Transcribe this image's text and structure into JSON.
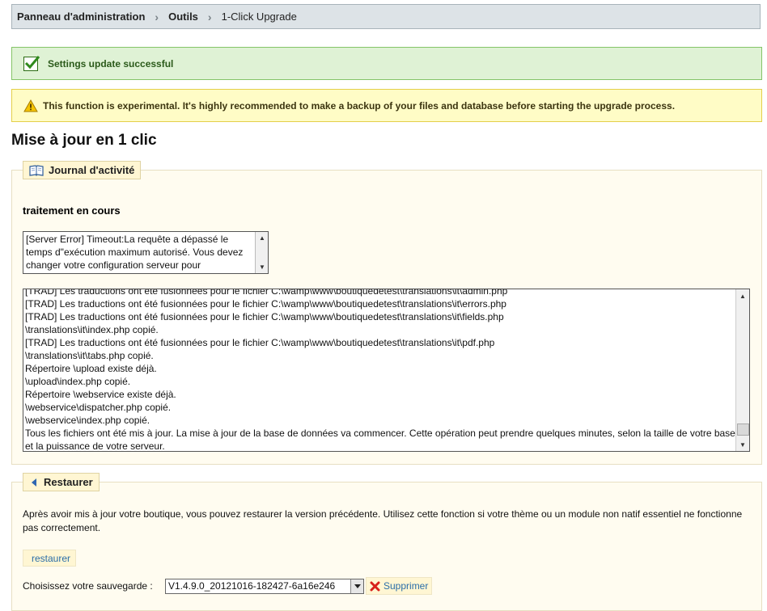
{
  "breadcrumb": {
    "items": [
      "Panneau d'administration",
      "Outils",
      "1-Click Upgrade"
    ]
  },
  "confirmation": {
    "text": "Settings update successful",
    "icon": "check-icon"
  },
  "warning": {
    "text": "This function is experimental. It's highly recommended to make a backup of your files and database before starting the upgrade process.",
    "icon": "warning-icon"
  },
  "page": {
    "title": "Mise à jour en 1 clic"
  },
  "activity": {
    "legend": "Journal d'activité",
    "legend_icon": "book-icon",
    "status": "traitement en cours",
    "error_log": "[Server Error] Timeout:La requête a dépassé le temps d\"exécution maximum autorisé. Vous devez changer votre configuration serveur pour",
    "log_lines": [
      "[TRAD] Les traductions ont été fusionnées pour le fichier C:\\wamp\\www\\boutiquedetest\\translations\\it\\admin.php",
      "[TRAD] Les traductions ont été fusionnées pour le fichier C:\\wamp\\www\\boutiquedetest\\translations\\it\\errors.php",
      "[TRAD] Les traductions ont été fusionnées pour le fichier C:\\wamp\\www\\boutiquedetest\\translations\\it\\fields.php",
      "\\translations\\it\\index.php copié.",
      "[TRAD] Les traductions ont été fusionnées pour le fichier C:\\wamp\\www\\boutiquedetest\\translations\\it\\pdf.php",
      "\\translations\\it\\tabs.php copié.",
      "Répertoire \\upload existe déjà.",
      "\\upload\\index.php copié.",
      "Répertoire \\webservice existe déjà.",
      "\\webservice\\dispatcher.php copié.",
      "\\webservice\\index.php copié.",
      "Tous les fichiers ont été mis à jour. La mise à jour de la base de données va commencer. Cette opération peut prendre quelques minutes, selon la taille de votre base et la puissance de votre serveur."
    ]
  },
  "restore": {
    "legend": "Restaurer",
    "legend_icon": "arrow-left-icon",
    "description": "Après avoir mis à jour votre boutique, vous pouvez restaurer la version précédente. Utilisez cette fonction si votre thème ou un module non natif essentiel ne fonctionne pas correctement.",
    "restore_button": "restaurer",
    "choose_label": "Choisissez votre sauvegarde :",
    "selected_backup": "V1.4.9.0_20121016-182427-6a16e246",
    "delete_button": "Supprimer",
    "delete_icon": "delete-icon"
  },
  "colors": {
    "success_bg": "#dff2d5",
    "warning_bg": "#fffcc6",
    "fieldset_bg": "#fffcf0",
    "link": "#2b6ea8"
  }
}
